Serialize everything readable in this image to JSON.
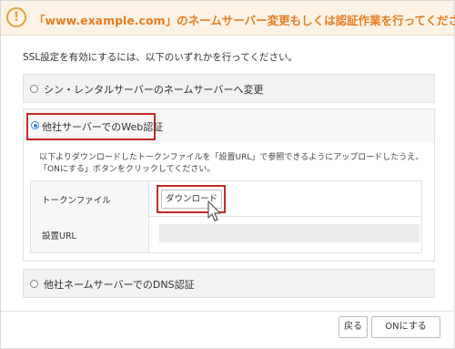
{
  "warning": {
    "icon": "exclamation-circle-icon",
    "title": "「www.example.com」のネームサーバー変更もしくは認証作業を行ってください",
    "color": "#e67e22"
  },
  "intro_text": "SSL設定を有効にするには、以下のいずれかを行ってください。",
  "options": [
    {
      "label": "シン・レンタルサーバーのネームサーバーへ変更",
      "selected": false
    },
    {
      "label": "他社サーバーでのWeb認証",
      "selected": true
    },
    {
      "label": "他社ネームサーバーでのDNS認証",
      "selected": false
    }
  ],
  "web_auth": {
    "description_line1": "以下よりダウンロードしたトークンファイルを「設置URL」で参照できるようにアップロードしたうえ、",
    "description_line2": "「ONにする」ボタンをクリックしてください。",
    "token_label": "トークンファイル",
    "download_label": "ダウンロード",
    "url_label": "設置URL",
    "url_value": ""
  },
  "footer": {
    "back_label": "戻る",
    "on_label": "ONにする"
  },
  "colors": {
    "accent_red": "#c62828",
    "radio_blue": "#3b82f6",
    "warning_bg": "#fcf2e6"
  }
}
